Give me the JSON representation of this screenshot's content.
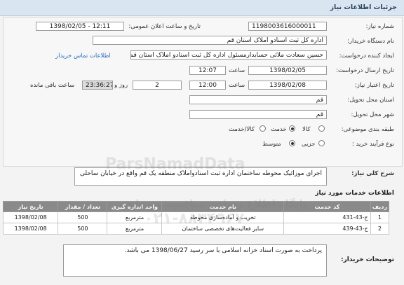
{
  "page": {
    "title": "جزئیات اطلاعات نیاز"
  },
  "form": {
    "need_number_label": "شماره نیاز:",
    "need_number": "1198003616000011",
    "announce_label": "تاریخ و ساعت اعلان عمومی:",
    "announce_value": "1398/02/05 - 12:11",
    "buyer_label": "نام دستگاه خریدار:",
    "buyer_value": "اداره کل ثبت اسنادو املاک استان قم",
    "creator_label": "ایجاد کننده درخواست:",
    "creator_value": "حسین سعادت ملائی حسابدارمسئول اداره کل ثبت اسنادو املاک استان قم",
    "contact_link": "اطلاعات تماس خریدار",
    "send_date_label": "تاریخ ارسال درخواست:",
    "send_date": "1398/02/05",
    "send_time_label": "ساعت",
    "send_time": "12:07",
    "validity_label": "تاریخ اعتبار نیاز:",
    "validity_date": "1398/02/08",
    "validity_time_label": "ساعت",
    "validity_time": "12:00",
    "days_value": "2",
    "days_label": "روز و",
    "remaining_time": "23:36:27",
    "remaining_label": "ساعت باقی مانده",
    "province_label": "استان محل تحویل:",
    "province_value": "قم",
    "city_label": "شهر محل تحویل:",
    "city_value": "قم",
    "category_label": "طبقه بندی موضوعی:",
    "category_options": [
      "کالا",
      "خدمت",
      "کالا/خدمت"
    ],
    "category_selected": "خدمت",
    "process_label": "نوع فرآیند خرید :",
    "process_options": [
      "جزیی",
      "متوسط"
    ],
    "process_selected": "متوسط",
    "general_desc_label": "شرح کلی نیاز:",
    "general_desc": "اجرای موزائیک محوطه ساختمان اداره ثبت اسنادواملاک منطقه یک قم واقع در خیابان ساحلی"
  },
  "services": {
    "title": "اطلاعات خدمات مورد نیاز",
    "columns": [
      "ردیف",
      "کد خدمت",
      "نام خدمت",
      "واحد اندازه گیری",
      "تعداد / مقدار",
      "تاریخ نیاز"
    ],
    "rows": [
      [
        "1",
        "ج-43-431",
        "تخریب و آماده‌سازی محوطه",
        "مترمربع",
        "500",
        "1398/02/08"
      ],
      [
        "2",
        "ج-43-439",
        "سایر فعالیت‌های تخصصی ساختمان",
        "مترمربع",
        "500",
        "1398/02/08"
      ]
    ]
  },
  "notes": {
    "label": "توضیحات خریدار:",
    "text": "پرداخت به صورت اسناد خزانه اسلامی با سر رسید 1398/06/27 می باشد."
  },
  "watermark": {
    "brand": "ParsNamadData",
    "line1": "پایگاه اطلاع رسانی مناقصه و مزایده",
    "line2": "۰۲۱-۸۸۳۴۹۶۷۰"
  }
}
